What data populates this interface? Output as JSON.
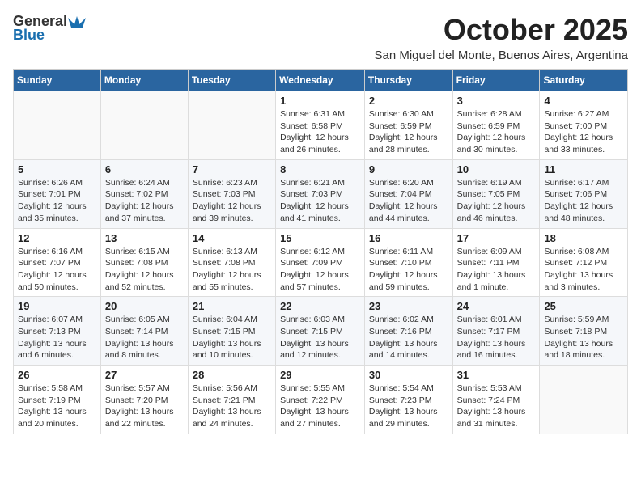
{
  "logo": {
    "general": "General",
    "blue": "Blue"
  },
  "title": "October 2025",
  "subtitle": "San Miguel del Monte, Buenos Aires, Argentina",
  "days_header": [
    "Sunday",
    "Monday",
    "Tuesday",
    "Wednesday",
    "Thursday",
    "Friday",
    "Saturday"
  ],
  "weeks": [
    [
      {
        "day": "",
        "info": ""
      },
      {
        "day": "",
        "info": ""
      },
      {
        "day": "",
        "info": ""
      },
      {
        "day": "1",
        "info": "Sunrise: 6:31 AM\nSunset: 6:58 PM\nDaylight: 12 hours\nand 26 minutes."
      },
      {
        "day": "2",
        "info": "Sunrise: 6:30 AM\nSunset: 6:59 PM\nDaylight: 12 hours\nand 28 minutes."
      },
      {
        "day": "3",
        "info": "Sunrise: 6:28 AM\nSunset: 6:59 PM\nDaylight: 12 hours\nand 30 minutes."
      },
      {
        "day": "4",
        "info": "Sunrise: 6:27 AM\nSunset: 7:00 PM\nDaylight: 12 hours\nand 33 minutes."
      }
    ],
    [
      {
        "day": "5",
        "info": "Sunrise: 6:26 AM\nSunset: 7:01 PM\nDaylight: 12 hours\nand 35 minutes."
      },
      {
        "day": "6",
        "info": "Sunrise: 6:24 AM\nSunset: 7:02 PM\nDaylight: 12 hours\nand 37 minutes."
      },
      {
        "day": "7",
        "info": "Sunrise: 6:23 AM\nSunset: 7:03 PM\nDaylight: 12 hours\nand 39 minutes."
      },
      {
        "day": "8",
        "info": "Sunrise: 6:21 AM\nSunset: 7:03 PM\nDaylight: 12 hours\nand 41 minutes."
      },
      {
        "day": "9",
        "info": "Sunrise: 6:20 AM\nSunset: 7:04 PM\nDaylight: 12 hours\nand 44 minutes."
      },
      {
        "day": "10",
        "info": "Sunrise: 6:19 AM\nSunset: 7:05 PM\nDaylight: 12 hours\nand 46 minutes."
      },
      {
        "day": "11",
        "info": "Sunrise: 6:17 AM\nSunset: 7:06 PM\nDaylight: 12 hours\nand 48 minutes."
      }
    ],
    [
      {
        "day": "12",
        "info": "Sunrise: 6:16 AM\nSunset: 7:07 PM\nDaylight: 12 hours\nand 50 minutes."
      },
      {
        "day": "13",
        "info": "Sunrise: 6:15 AM\nSunset: 7:08 PM\nDaylight: 12 hours\nand 52 minutes."
      },
      {
        "day": "14",
        "info": "Sunrise: 6:13 AM\nSunset: 7:08 PM\nDaylight: 12 hours\nand 55 minutes."
      },
      {
        "day": "15",
        "info": "Sunrise: 6:12 AM\nSunset: 7:09 PM\nDaylight: 12 hours\nand 57 minutes."
      },
      {
        "day": "16",
        "info": "Sunrise: 6:11 AM\nSunset: 7:10 PM\nDaylight: 12 hours\nand 59 minutes."
      },
      {
        "day": "17",
        "info": "Sunrise: 6:09 AM\nSunset: 7:11 PM\nDaylight: 13 hours\nand 1 minute."
      },
      {
        "day": "18",
        "info": "Sunrise: 6:08 AM\nSunset: 7:12 PM\nDaylight: 13 hours\nand 3 minutes."
      }
    ],
    [
      {
        "day": "19",
        "info": "Sunrise: 6:07 AM\nSunset: 7:13 PM\nDaylight: 13 hours\nand 6 minutes."
      },
      {
        "day": "20",
        "info": "Sunrise: 6:05 AM\nSunset: 7:14 PM\nDaylight: 13 hours\nand 8 minutes."
      },
      {
        "day": "21",
        "info": "Sunrise: 6:04 AM\nSunset: 7:15 PM\nDaylight: 13 hours\nand 10 minutes."
      },
      {
        "day": "22",
        "info": "Sunrise: 6:03 AM\nSunset: 7:15 PM\nDaylight: 13 hours\nand 12 minutes."
      },
      {
        "day": "23",
        "info": "Sunrise: 6:02 AM\nSunset: 7:16 PM\nDaylight: 13 hours\nand 14 minutes."
      },
      {
        "day": "24",
        "info": "Sunrise: 6:01 AM\nSunset: 7:17 PM\nDaylight: 13 hours\nand 16 minutes."
      },
      {
        "day": "25",
        "info": "Sunrise: 5:59 AM\nSunset: 7:18 PM\nDaylight: 13 hours\nand 18 minutes."
      }
    ],
    [
      {
        "day": "26",
        "info": "Sunrise: 5:58 AM\nSunset: 7:19 PM\nDaylight: 13 hours\nand 20 minutes."
      },
      {
        "day": "27",
        "info": "Sunrise: 5:57 AM\nSunset: 7:20 PM\nDaylight: 13 hours\nand 22 minutes."
      },
      {
        "day": "28",
        "info": "Sunrise: 5:56 AM\nSunset: 7:21 PM\nDaylight: 13 hours\nand 24 minutes."
      },
      {
        "day": "29",
        "info": "Sunrise: 5:55 AM\nSunset: 7:22 PM\nDaylight: 13 hours\nand 27 minutes."
      },
      {
        "day": "30",
        "info": "Sunrise: 5:54 AM\nSunset: 7:23 PM\nDaylight: 13 hours\nand 29 minutes."
      },
      {
        "day": "31",
        "info": "Sunrise: 5:53 AM\nSunset: 7:24 PM\nDaylight: 13 hours\nand 31 minutes."
      },
      {
        "day": "",
        "info": ""
      }
    ]
  ]
}
